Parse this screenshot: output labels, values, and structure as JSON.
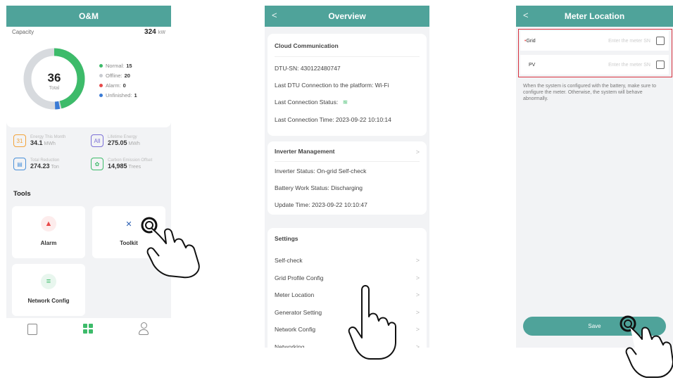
{
  "screen1": {
    "title": "O&M",
    "capacity_label": "Capacity",
    "capacity_value": "324",
    "capacity_unit": "kW",
    "total_value": "36",
    "total_label": "Total",
    "legend": [
      {
        "label": "Normal:",
        "value": "15",
        "color": "#3dbb6a"
      },
      {
        "label": "Offline:",
        "value": "20",
        "color": "#c8cbd0"
      },
      {
        "label": "Alarm:",
        "value": "0",
        "color": "#e84a4a"
      },
      {
        "label": "Unfinished:",
        "value": "1",
        "color": "#3a7bd5"
      }
    ],
    "stats": [
      {
        "label": "Energy This Month",
        "value": "34.1",
        "unit": "MWh",
        "icon": "calendar-icon",
        "glyph": "31",
        "color": "#f2a33a"
      },
      {
        "label": "Lifetime Energy",
        "value": "275.05",
        "unit": "MWh",
        "icon": "all-energy-icon",
        "glyph": "All",
        "color": "#7b6fd6"
      },
      {
        "label": "Total Reduction",
        "value": "274.23",
        "unit": "Ton",
        "icon": "reduction-icon",
        "glyph": "▤",
        "color": "#4a90d9"
      },
      {
        "label": "Carbon Emission Offset",
        "value": "14,985",
        "unit": "Trees",
        "icon": "tree-icon",
        "glyph": "✿",
        "color": "#3dbb6a"
      }
    ],
    "tools_heading": "Tools",
    "tools": [
      {
        "label": "Alarm",
        "icon": "alarm-icon",
        "glyph": "▲",
        "color": "#e84a4a",
        "bg": "#fdecec"
      },
      {
        "label": "Toolkit",
        "icon": "toolkit-icon",
        "glyph": "✕",
        "color": "#2b5fb3",
        "bg": "#ffffff"
      },
      {
        "label": "Network Config",
        "icon": "network-icon",
        "glyph": "≡",
        "color": "#3dbb6a",
        "bg": "#e8f6ee"
      }
    ],
    "nav": [
      {
        "icon": "list-icon",
        "active": false
      },
      {
        "icon": "grid-icon",
        "active": true
      },
      {
        "icon": "user-icon",
        "active": false
      }
    ]
  },
  "screen2": {
    "title": "Overview",
    "cloud_heading": "Cloud Communication",
    "dtu_sn": "DTU-SN:  430122480747",
    "last_conn_platform": "Last DTU Connection to the platform:  Wi-Fi",
    "last_conn_status": "Last Connection Status:",
    "last_conn_time": "Last Connection Time:  2023-09-22 10:10:14",
    "inverter_heading": "Inverter Management",
    "inverter_status": "Inverter Status:  On-grid Self-check",
    "battery_status": "Battery Work Status:  Discharging",
    "update_time": "Update Time:  2023-09-22 10:10:47",
    "settings_heading": "Settings",
    "settings_items": [
      "Self-check",
      "Grid Profile Config",
      "Meter Location",
      "Generator Setting",
      "Network Config",
      "Networking"
    ]
  },
  "screen3": {
    "title": "Meter Location",
    "grid_label": "Grid",
    "pv_label": "PV",
    "placeholder": "Enter the meter SN",
    "note": "When the system is configured with the battery, make sure to configure the meter. Otherwise, the system will behave abnormally.",
    "save_label": "Save"
  }
}
